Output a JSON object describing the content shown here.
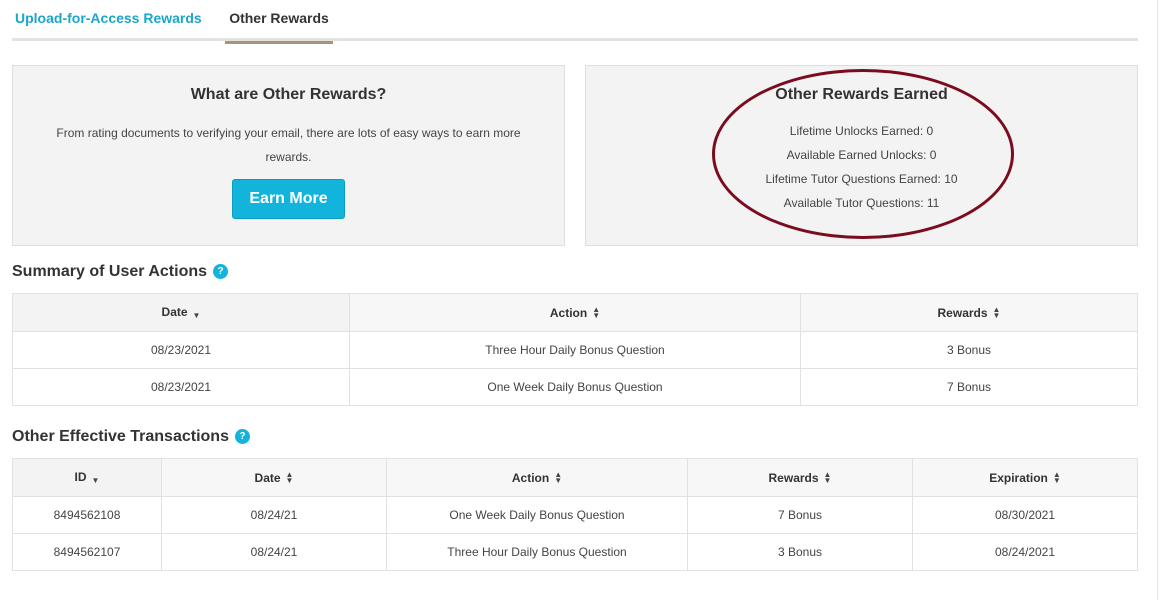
{
  "tabs": [
    {
      "label": "Upload-for-Access Rewards"
    },
    {
      "label": "Other Rewards"
    }
  ],
  "info_card": {
    "title": "What are Other Rewards?",
    "description": "From rating documents to verifying your email, there are lots of easy ways to earn more rewards.",
    "button_label": "Earn More"
  },
  "earned_card": {
    "title": "Other Rewards Earned",
    "stats": [
      "Lifetime Unlocks Earned: 0",
      "Available Earned Unlocks: 0",
      "Lifetime Tutor Questions Earned: 10",
      "Available Tutor Questions: 11"
    ],
    "highlight_color": "#7a0c1f"
  },
  "summary": {
    "title": "Summary of User Actions",
    "help_icon": "question-circle-icon",
    "columns": [
      "Date",
      "Action",
      "Rewards"
    ],
    "rows": [
      [
        "08/23/2021",
        "Three Hour Daily Bonus Question",
        "3 Bonus"
      ],
      [
        "08/23/2021",
        "One Week Daily Bonus Question",
        "7 Bonus"
      ]
    ]
  },
  "transactions": {
    "title": "Other Effective Transactions",
    "help_icon": "question-circle-icon",
    "columns": [
      "ID",
      "Date",
      "Action",
      "Rewards",
      "Expiration"
    ],
    "rows": [
      [
        "8494562108",
        "08/24/21",
        "One Week Daily Bonus Question",
        "7 Bonus",
        "08/30/2021"
      ],
      [
        "8494562107",
        "08/24/21",
        "Three Hour Daily Bonus Question",
        "3 Bonus",
        "08/24/2021"
      ]
    ]
  },
  "colors": {
    "accent": "#12b4dc",
    "tab_underline": "#a8947a"
  }
}
